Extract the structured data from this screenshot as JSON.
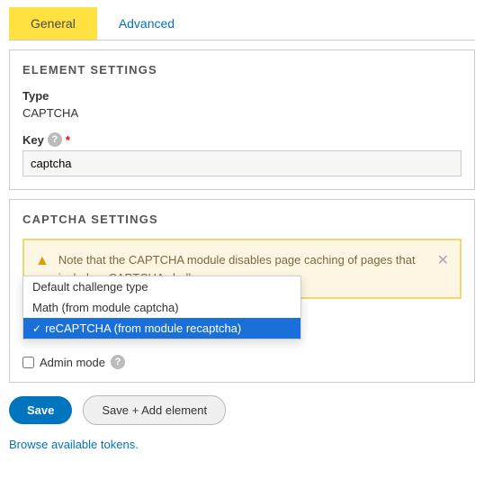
{
  "tabs": {
    "general": "General",
    "advanced": "Advanced"
  },
  "element_settings": {
    "title": "ELEMENT SETTINGS",
    "type_label": "Type",
    "type_value": "CAPTCHA",
    "key_label": "Key",
    "key_value": "captcha"
  },
  "captcha_settings": {
    "title": "CAPTCHA SETTINGS",
    "alert": "Note that the CAPTCHA module disables page caching of pages that include a CAPTCHA challenge.",
    "options": [
      "Default challenge type",
      "Math (from module captcha)",
      "reCAPTCHA (from module recaptcha)"
    ],
    "admin_mode": "Admin mode"
  },
  "actions": {
    "save": "Save",
    "save_add": "Save + Add element"
  },
  "tokens_link": "Browse available tokens."
}
